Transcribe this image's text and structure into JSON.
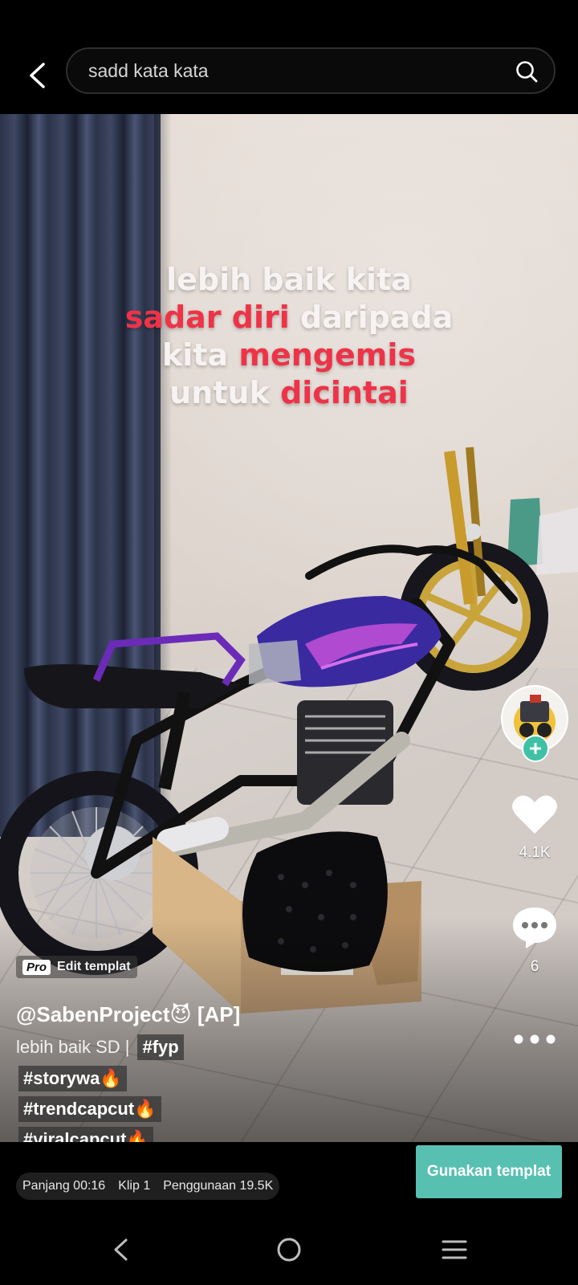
{
  "search": {
    "query": "sadd kata kata"
  },
  "caption": {
    "line1": [
      {
        "text": "lebih baik kita",
        "color": "white"
      }
    ],
    "line2": [
      {
        "text": "sadar diri",
        "color": "red"
      },
      {
        "text": " daripada",
        "color": "white"
      }
    ],
    "line3": [
      {
        "text": "kita ",
        "color": "white"
      },
      {
        "text": "mengemis",
        "color": "red"
      }
    ],
    "line4": [
      {
        "text": "untuk ",
        "color": "white"
      },
      {
        "text": "dicintai",
        "color": "red"
      }
    ],
    "colors": {
      "white": "#f6f3f2",
      "red": "#ee3348"
    }
  },
  "rail": {
    "likes": "4.1K",
    "comments": "6"
  },
  "template": {
    "badge": "Pro",
    "edit_label": "Edit templat"
  },
  "post": {
    "username": "@SabenProject😈 [AP]",
    "desc_text": "lebih baik SD |",
    "tags": [
      "#fyp",
      "#storywa🔥",
      "#trendcapcut🔥",
      "#viralcapcut🔥"
    ]
  },
  "stats": {
    "length": "Panjang 00:16",
    "clips": "Klip 1",
    "usage": "Penggunaan 19.5K"
  },
  "use_button": "Gunakan templat",
  "accent_color": "#58c0b1",
  "follow_color": "#3fc1a6"
}
